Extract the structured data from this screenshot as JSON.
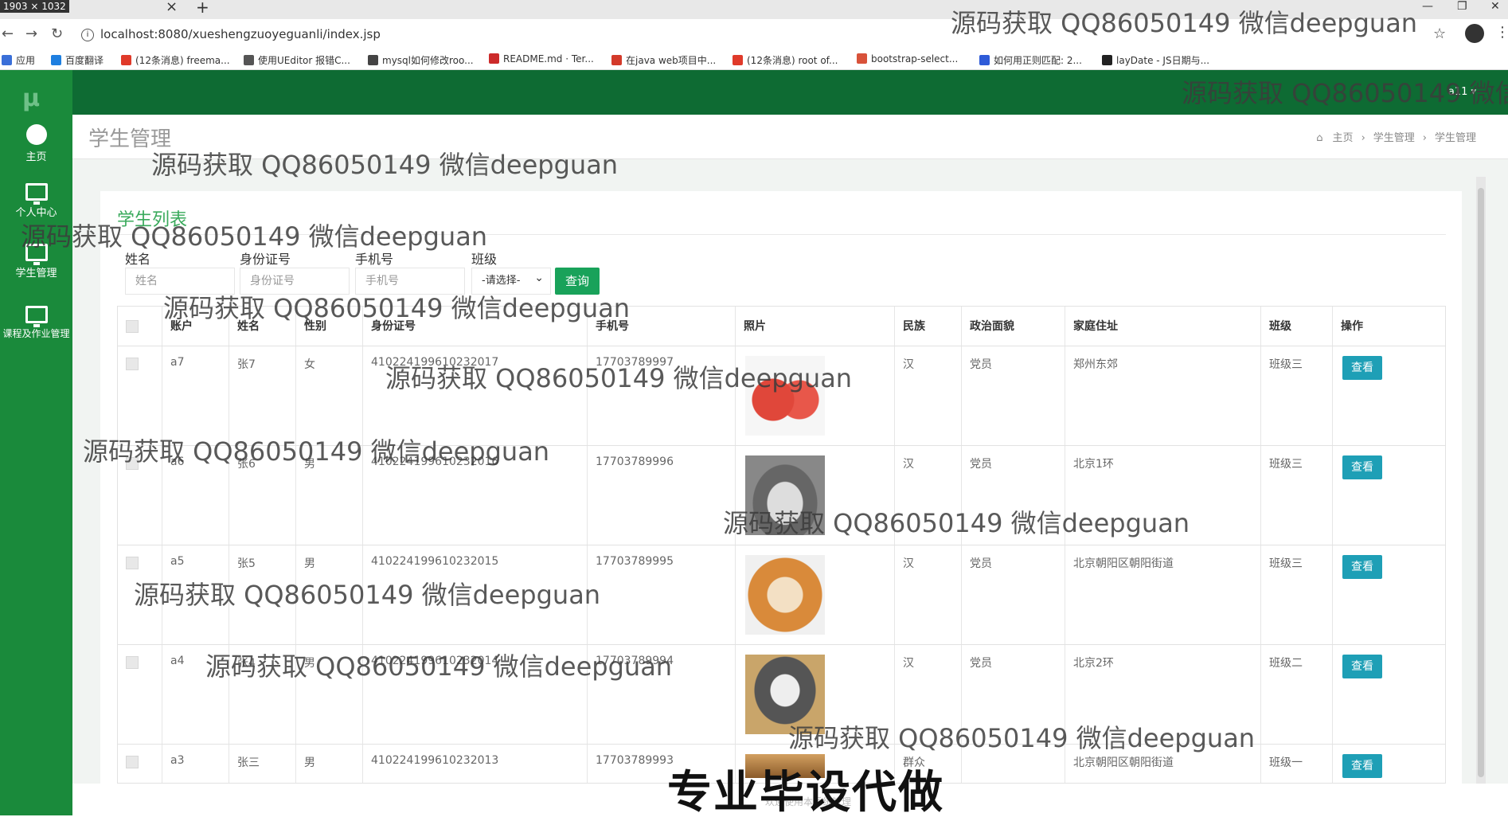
{
  "browser": {
    "tab_dimensions": "1903 × 1032",
    "url": "localhost:8080/xueshengzuoyeguanli/index.jsp",
    "bookmarks": [
      "应用",
      "百度翻译",
      "(12条消息) freema...",
      "使用UEditor 报错C...",
      "mysql如何修改roo...",
      "README.md · Ter...",
      "在java web项目中...",
      "(12条消息) root of...",
      "bootstrap-select...",
      "如何用正则匹配: 2...",
      "layDate - JS日期与..."
    ],
    "bookmark_colors": [
      "#3a6fd8",
      "#1e7fe0",
      "#e03a2a",
      "#555555",
      "#444444",
      "#cc2a2a",
      "#d33a2a",
      "#e03a2a",
      "#d8523a",
      "#2e5bd8",
      "#222222"
    ]
  },
  "sidebar": {
    "logo": "μ",
    "items": [
      {
        "label": "主页",
        "icon": "dashboard-icon"
      },
      {
        "label": "个人中心",
        "icon": "monitor-icon"
      },
      {
        "label": "学生管理",
        "icon": "monitor-icon"
      },
      {
        "label": "课程及作业管理",
        "icon": "monitor-icon"
      }
    ]
  },
  "topbar": {
    "user": "a11 ▾"
  },
  "header": {
    "title": "学生管理",
    "breadcrumb": [
      "主页",
      "学生管理",
      "学生管理"
    ]
  },
  "list": {
    "title": "学生列表",
    "filters": {
      "name_label": "姓名",
      "name_placeholder": "姓名",
      "id_label": "身份证号",
      "id_placeholder": "身份证号",
      "phone_label": "手机号",
      "phone_placeholder": "手机号",
      "class_label": "班级",
      "class_selected": "-请选择-"
    },
    "query_button": "查询"
  },
  "table": {
    "columns": [
      "",
      "账户",
      "姓名",
      "性别",
      "身份证号",
      "手机号",
      "照片",
      "民族",
      "政治面貌",
      "家庭住址",
      "班级",
      "操作"
    ],
    "rows": [
      {
        "account": "a7",
        "name": "张7",
        "gender": "女",
        "id": "410224199610232017",
        "phone": "17703789997",
        "photo": "apple",
        "ethnic": "汉",
        "politics": "党员",
        "address": "郑州东郊",
        "class": "班级三",
        "action": "查看"
      },
      {
        "account": "a6",
        "name": "张6",
        "gender": "男",
        "id": "410224199610232016",
        "phone": "17703789996",
        "photo": "husky",
        "ethnic": "汉",
        "politics": "党员",
        "address": "北京1环",
        "class": "班级三",
        "action": "查看"
      },
      {
        "account": "a5",
        "name": "张5",
        "gender": "男",
        "id": "410224199610232015",
        "phone": "17703789995",
        "photo": "shiba",
        "ethnic": "汉",
        "politics": "党员",
        "address": "北京朝阳区朝阳街道",
        "class": "班级三",
        "action": "查看"
      },
      {
        "account": "a4",
        "name": "张4",
        "gender": "男",
        "id": "410224199610232014",
        "phone": "17703789994",
        "photo": "cat",
        "ethnic": "汉",
        "politics": "党员",
        "address": "北京2环",
        "class": "班级二",
        "action": "查看"
      },
      {
        "account": "a3",
        "name": "张三",
        "gender": "男",
        "id": "410224199610232013",
        "phone": "17703789993",
        "photo": "dog",
        "ethnic": "群众",
        "politics": "",
        "address": "北京朝阳区朝阳街道",
        "class": "班级一",
        "action": "查看"
      }
    ]
  },
  "watermark": "源码获取 QQ86050149 微信deepguan",
  "promo": "专业毕设代做",
  "footer_note": "欢迎使用本系统管理"
}
